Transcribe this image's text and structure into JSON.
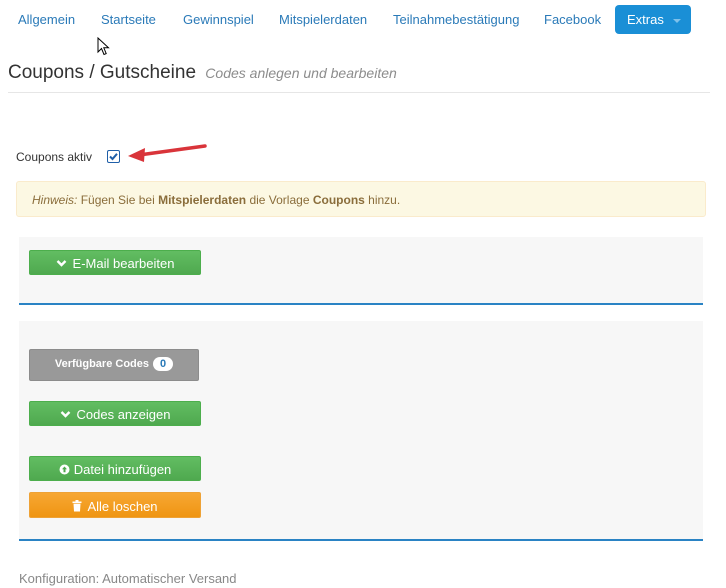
{
  "nav": {
    "items": [
      "Allgemein",
      "Startseite",
      "Gewinnspiel",
      "Mitspielerdaten",
      "Teilnahmebestätigung",
      "Facebook"
    ],
    "extras_label": "Extras"
  },
  "header": {
    "title": "Coupons / Gutscheine",
    "subtitle": "Codes anlegen und bearbeiten"
  },
  "coupons_active": {
    "label": "Coupons aktiv",
    "checked": true
  },
  "hint": {
    "prefix": "Hinweis:",
    "text1": " Fügen Sie bei ",
    "bold1": "Mitspielerdaten",
    "text2": " die Vorlage ",
    "bold2": "Coupons",
    "text3": " hinzu."
  },
  "email_button": "E-Mail bearbeiten",
  "codes": {
    "available_label": "Verfügbare Codes",
    "available_count": "0",
    "show_button": "Codes anzeigen",
    "add_file_button": "Datei hinzufügen",
    "delete_all_button": "Alle loschen"
  },
  "footer": "Konfiguration: Automatischer Versand",
  "colors": {
    "accent": "#1a8fd6",
    "link": "#2a7ab8",
    "success": "#5cb85c",
    "warning": "#f0ad4e",
    "annotation_arrow": "#d9343a"
  },
  "icons": {
    "email_button": "chevron-down-icon",
    "show_button": "chevron-down-icon",
    "add_file_button": "upload-circle-icon",
    "delete_all_button": "trash-icon",
    "annotation": "red-arrow-icon",
    "cursor": "mouse-cursor-icon"
  }
}
